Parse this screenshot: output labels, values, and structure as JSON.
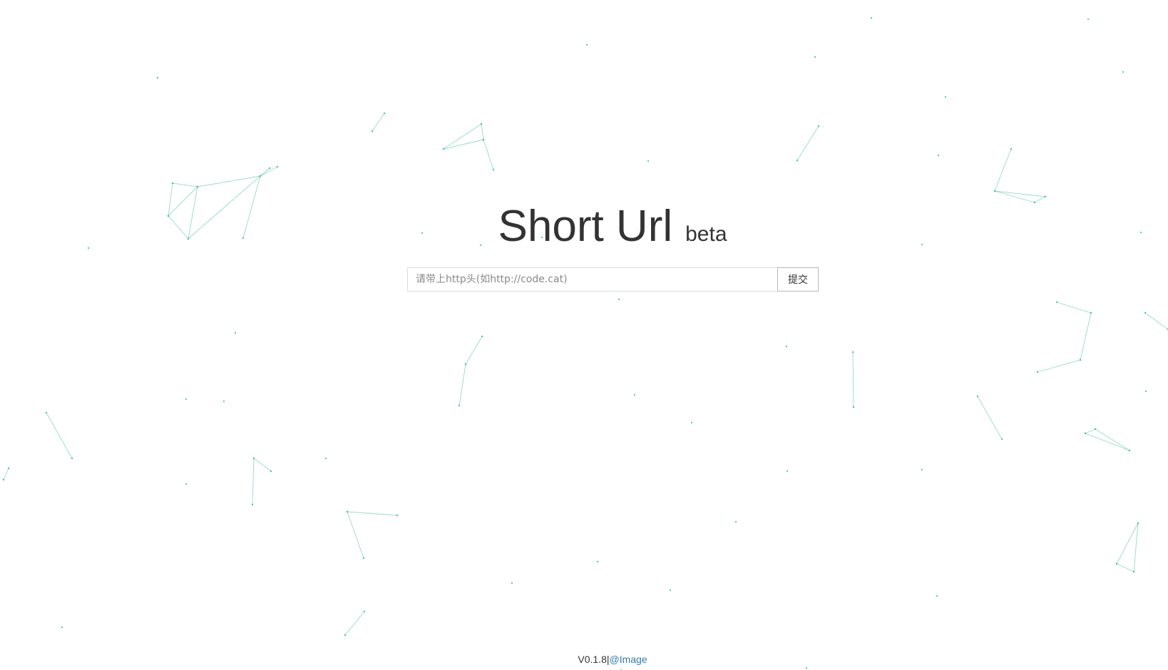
{
  "header": {
    "title": "Short Url",
    "subtitle": "beta"
  },
  "form": {
    "url_placeholder": "请带上http头(如http://code.cat)",
    "url_value": "",
    "submit_label": "提交"
  },
  "footer": {
    "version": "V0.1.8",
    "separator": "|",
    "link_label": "@Image"
  },
  "colors": {
    "text": "#333333",
    "link": "#337ab7",
    "network_line": "#4cc3a6",
    "background": "#ffffff"
  }
}
